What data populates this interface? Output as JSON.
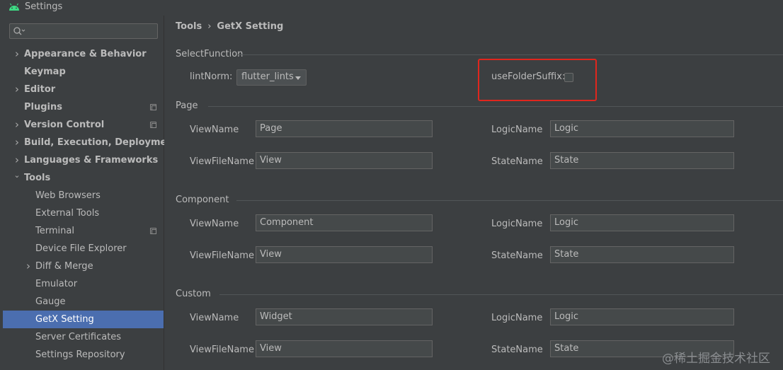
{
  "window": {
    "title": "Settings",
    "logo_icon": "android-icon"
  },
  "search": {
    "placeholder": "",
    "value": ""
  },
  "sidebar": {
    "items": [
      {
        "label": "Appearance & Behavior",
        "bold": true,
        "expandable": true,
        "expanded": false
      },
      {
        "label": "Keymap",
        "bold": true
      },
      {
        "label": "Editor",
        "bold": true,
        "expandable": true,
        "expanded": false
      },
      {
        "label": "Plugins",
        "bold": true,
        "project_icon": true
      },
      {
        "label": "Version Control",
        "bold": true,
        "expandable": true,
        "project_icon": true
      },
      {
        "label": "Build, Execution, Deployment",
        "bold": true,
        "expandable": true
      },
      {
        "label": "Languages & Frameworks",
        "bold": true,
        "expandable": true
      },
      {
        "label": "Tools",
        "bold": true,
        "expandable": true,
        "expanded": true
      },
      {
        "label": "Web Browsers"
      },
      {
        "label": "External Tools"
      },
      {
        "label": "Terminal",
        "project_icon": true
      },
      {
        "label": "Device File Explorer"
      },
      {
        "label": "Diff & Merge",
        "expandable": true
      },
      {
        "label": "Emulator"
      },
      {
        "label": "Gauge"
      },
      {
        "label": "GetX Setting",
        "selected": true
      },
      {
        "label": "Server Certificates"
      },
      {
        "label": "Settings Repository"
      }
    ]
  },
  "breadcrumb": {
    "parent": "Tools",
    "separator": "›",
    "current": "GetX Setting"
  },
  "select_function": {
    "title": "SelectFunction",
    "lint_label": "lintNorm:",
    "lint_value": "flutter_lints",
    "folder_suffix_label": "useFolderSuffix:",
    "folder_suffix_checked": false
  },
  "sections": [
    {
      "title": "Page",
      "view_name_label": "ViewName",
      "view_name": "Page",
      "logic_name_label": "LogicName",
      "logic_name": "Logic",
      "view_file_name_label": "ViewFileName",
      "view_file_name": "View",
      "state_name_label": "StateName",
      "state_name": "State"
    },
    {
      "title": "Component",
      "view_name_label": "ViewName",
      "view_name": "Component",
      "logic_name_label": "LogicName",
      "logic_name": "Logic",
      "view_file_name_label": "ViewFileName",
      "view_file_name": "View",
      "state_name_label": "StateName",
      "state_name": "State"
    },
    {
      "title": "Custom",
      "view_name_label": "ViewName",
      "view_name": "Widget",
      "logic_name_label": "LogicName",
      "logic_name": "Logic",
      "view_file_name_label": "ViewFileName",
      "view_file_name": "View",
      "state_name_label": "StateName",
      "state_name": "State"
    }
  ],
  "watermark": "@稀土掘金技术社区",
  "colors": {
    "background": "#3c3f41",
    "selection": "#4b6eaf",
    "highlight": "#e0261d",
    "android": "#3ddc84"
  }
}
